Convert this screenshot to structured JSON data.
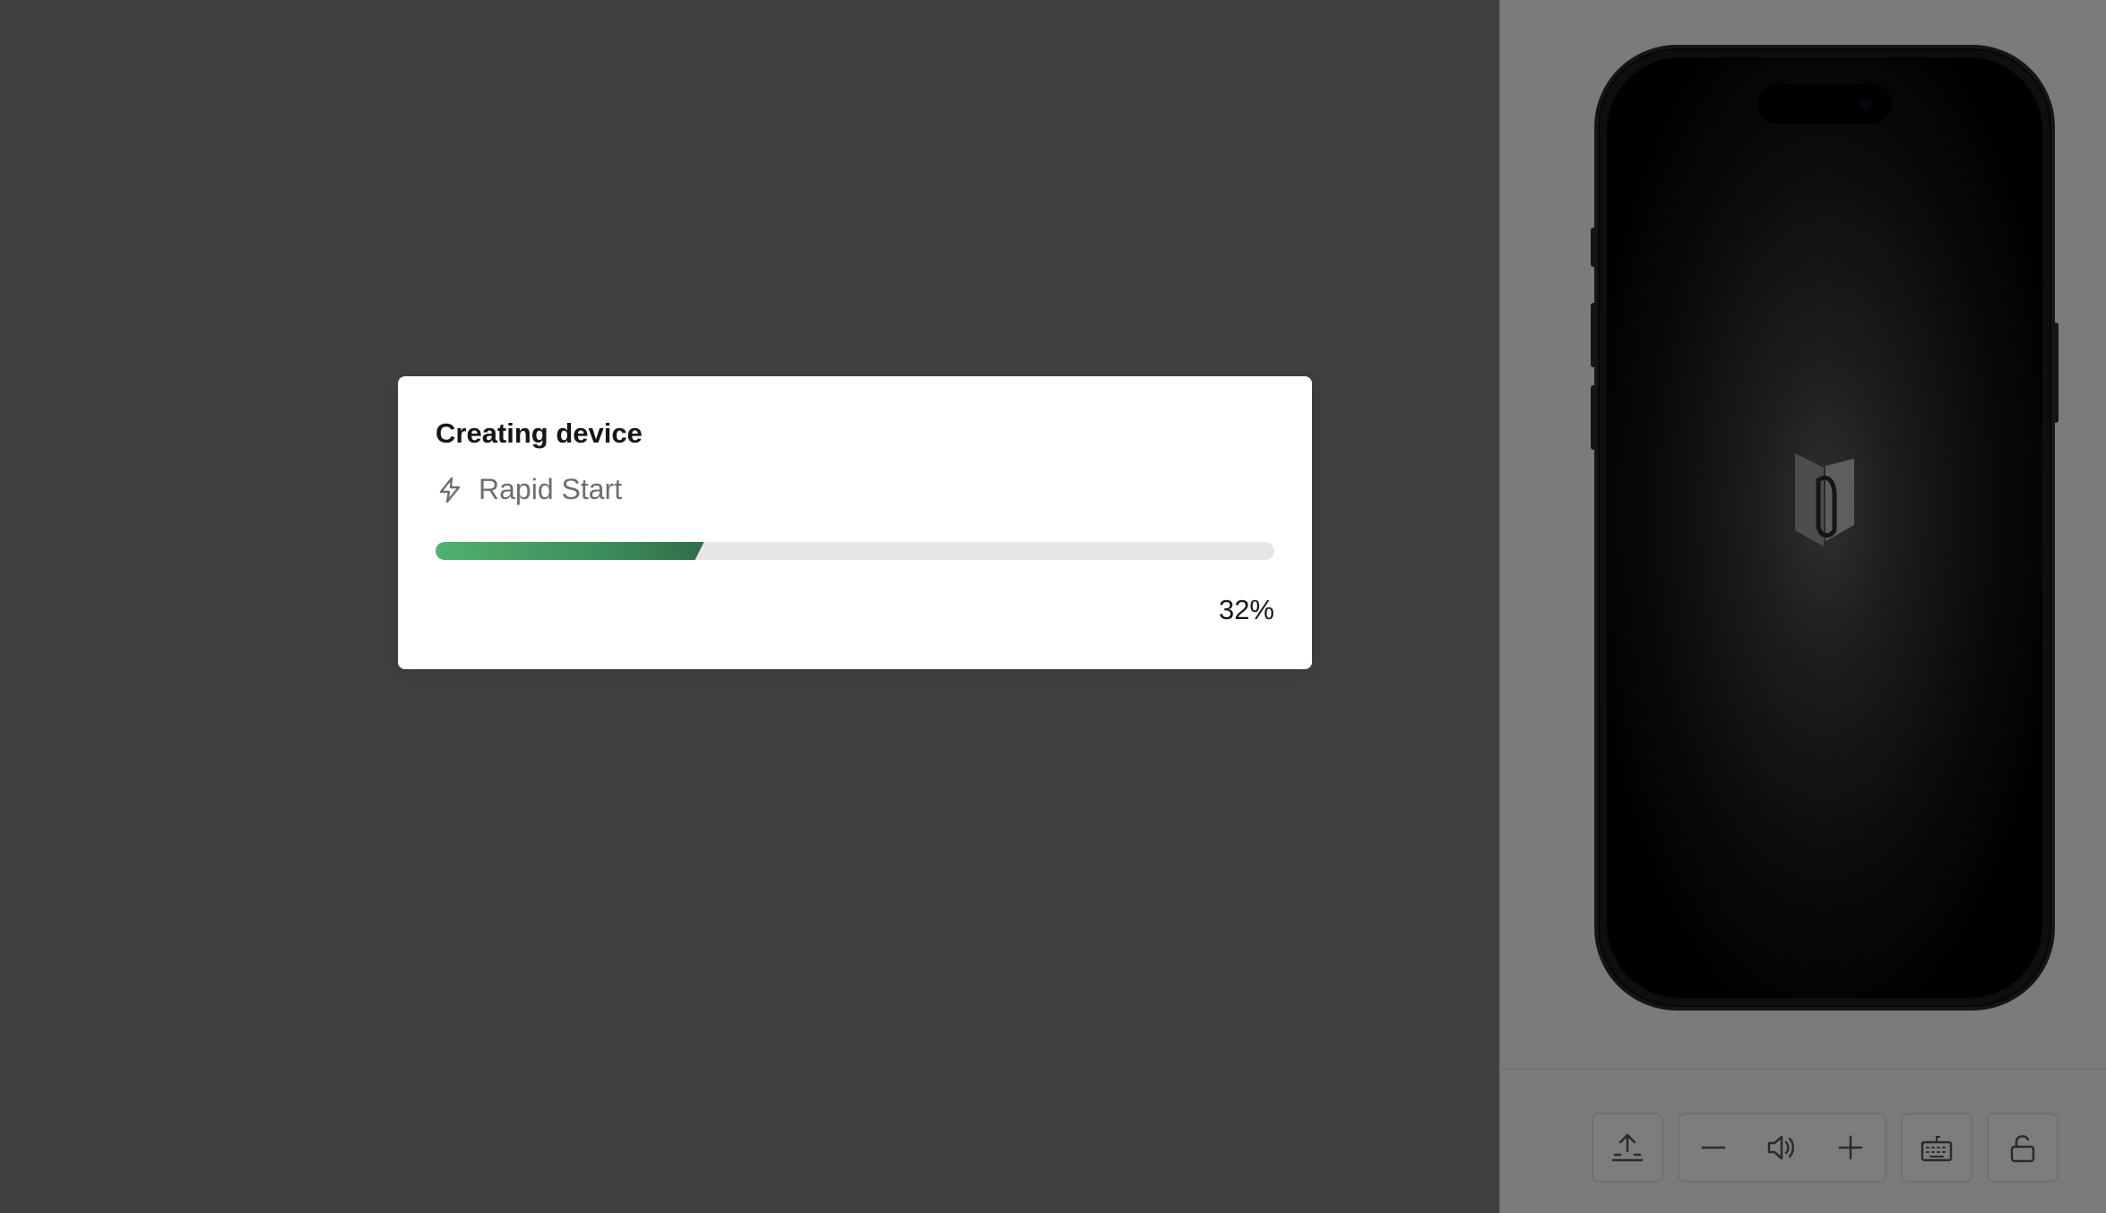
{
  "modal": {
    "title": "Creating device",
    "subtitle": "Rapid Start",
    "subtitle_icon": "lightning-bolt-icon",
    "progress_fraction": 0.32,
    "progress_label": "32%"
  },
  "device": {
    "type": "phone",
    "screen_state": "booting",
    "boot_logo_icon": "app-logo-icon"
  },
  "controls": [
    {
      "name": "upload-app",
      "icon": "upload-icon"
    },
    {
      "name": "volume-down",
      "icon": "minus-icon"
    },
    {
      "name": "volume",
      "icon": "speaker-icon"
    },
    {
      "name": "volume-up",
      "icon": "plus-icon"
    },
    {
      "name": "keyboard",
      "icon": "keyboard-icon"
    },
    {
      "name": "lock",
      "icon": "unlock-icon"
    }
  ],
  "colors": {
    "overlay_bg": "#808080",
    "progress_start": "#4fb26f",
    "progress_end": "#2f6e48",
    "track": "#e7e7e7"
  }
}
